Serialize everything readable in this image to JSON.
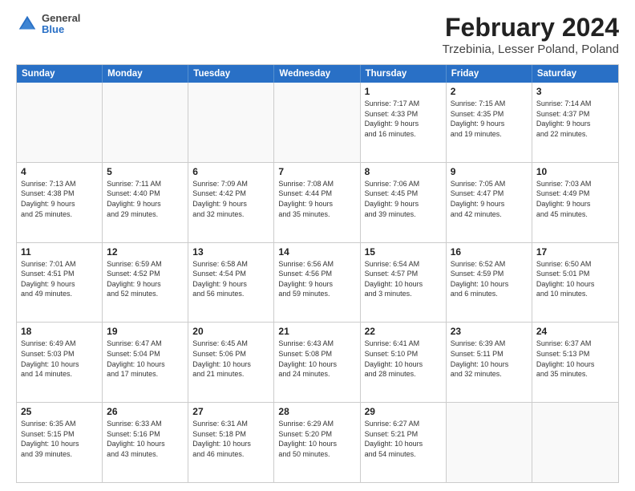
{
  "logo": {
    "general": "General",
    "blue": "Blue"
  },
  "header": {
    "title": "February 2024",
    "subtitle": "Trzebinia, Lesser Poland, Poland"
  },
  "days_of_week": [
    "Sunday",
    "Monday",
    "Tuesday",
    "Wednesday",
    "Thursday",
    "Friday",
    "Saturday"
  ],
  "weeks": [
    [
      {
        "day": "",
        "info": ""
      },
      {
        "day": "",
        "info": ""
      },
      {
        "day": "",
        "info": ""
      },
      {
        "day": "",
        "info": ""
      },
      {
        "day": "1",
        "info": "Sunrise: 7:17 AM\nSunset: 4:33 PM\nDaylight: 9 hours\nand 16 minutes."
      },
      {
        "day": "2",
        "info": "Sunrise: 7:15 AM\nSunset: 4:35 PM\nDaylight: 9 hours\nand 19 minutes."
      },
      {
        "day": "3",
        "info": "Sunrise: 7:14 AM\nSunset: 4:37 PM\nDaylight: 9 hours\nand 22 minutes."
      }
    ],
    [
      {
        "day": "4",
        "info": "Sunrise: 7:13 AM\nSunset: 4:38 PM\nDaylight: 9 hours\nand 25 minutes."
      },
      {
        "day": "5",
        "info": "Sunrise: 7:11 AM\nSunset: 4:40 PM\nDaylight: 9 hours\nand 29 minutes."
      },
      {
        "day": "6",
        "info": "Sunrise: 7:09 AM\nSunset: 4:42 PM\nDaylight: 9 hours\nand 32 minutes."
      },
      {
        "day": "7",
        "info": "Sunrise: 7:08 AM\nSunset: 4:44 PM\nDaylight: 9 hours\nand 35 minutes."
      },
      {
        "day": "8",
        "info": "Sunrise: 7:06 AM\nSunset: 4:45 PM\nDaylight: 9 hours\nand 39 minutes."
      },
      {
        "day": "9",
        "info": "Sunrise: 7:05 AM\nSunset: 4:47 PM\nDaylight: 9 hours\nand 42 minutes."
      },
      {
        "day": "10",
        "info": "Sunrise: 7:03 AM\nSunset: 4:49 PM\nDaylight: 9 hours\nand 45 minutes."
      }
    ],
    [
      {
        "day": "11",
        "info": "Sunrise: 7:01 AM\nSunset: 4:51 PM\nDaylight: 9 hours\nand 49 minutes."
      },
      {
        "day": "12",
        "info": "Sunrise: 6:59 AM\nSunset: 4:52 PM\nDaylight: 9 hours\nand 52 minutes."
      },
      {
        "day": "13",
        "info": "Sunrise: 6:58 AM\nSunset: 4:54 PM\nDaylight: 9 hours\nand 56 minutes."
      },
      {
        "day": "14",
        "info": "Sunrise: 6:56 AM\nSunset: 4:56 PM\nDaylight: 9 hours\nand 59 minutes."
      },
      {
        "day": "15",
        "info": "Sunrise: 6:54 AM\nSunset: 4:57 PM\nDaylight: 10 hours\nand 3 minutes."
      },
      {
        "day": "16",
        "info": "Sunrise: 6:52 AM\nSunset: 4:59 PM\nDaylight: 10 hours\nand 6 minutes."
      },
      {
        "day": "17",
        "info": "Sunrise: 6:50 AM\nSunset: 5:01 PM\nDaylight: 10 hours\nand 10 minutes."
      }
    ],
    [
      {
        "day": "18",
        "info": "Sunrise: 6:49 AM\nSunset: 5:03 PM\nDaylight: 10 hours\nand 14 minutes."
      },
      {
        "day": "19",
        "info": "Sunrise: 6:47 AM\nSunset: 5:04 PM\nDaylight: 10 hours\nand 17 minutes."
      },
      {
        "day": "20",
        "info": "Sunrise: 6:45 AM\nSunset: 5:06 PM\nDaylight: 10 hours\nand 21 minutes."
      },
      {
        "day": "21",
        "info": "Sunrise: 6:43 AM\nSunset: 5:08 PM\nDaylight: 10 hours\nand 24 minutes."
      },
      {
        "day": "22",
        "info": "Sunrise: 6:41 AM\nSunset: 5:10 PM\nDaylight: 10 hours\nand 28 minutes."
      },
      {
        "day": "23",
        "info": "Sunrise: 6:39 AM\nSunset: 5:11 PM\nDaylight: 10 hours\nand 32 minutes."
      },
      {
        "day": "24",
        "info": "Sunrise: 6:37 AM\nSunset: 5:13 PM\nDaylight: 10 hours\nand 35 minutes."
      }
    ],
    [
      {
        "day": "25",
        "info": "Sunrise: 6:35 AM\nSunset: 5:15 PM\nDaylight: 10 hours\nand 39 minutes."
      },
      {
        "day": "26",
        "info": "Sunrise: 6:33 AM\nSunset: 5:16 PM\nDaylight: 10 hours\nand 43 minutes."
      },
      {
        "day": "27",
        "info": "Sunrise: 6:31 AM\nSunset: 5:18 PM\nDaylight: 10 hours\nand 46 minutes."
      },
      {
        "day": "28",
        "info": "Sunrise: 6:29 AM\nSunset: 5:20 PM\nDaylight: 10 hours\nand 50 minutes."
      },
      {
        "day": "29",
        "info": "Sunrise: 6:27 AM\nSunset: 5:21 PM\nDaylight: 10 hours\nand 54 minutes."
      },
      {
        "day": "",
        "info": ""
      },
      {
        "day": "",
        "info": ""
      }
    ]
  ]
}
